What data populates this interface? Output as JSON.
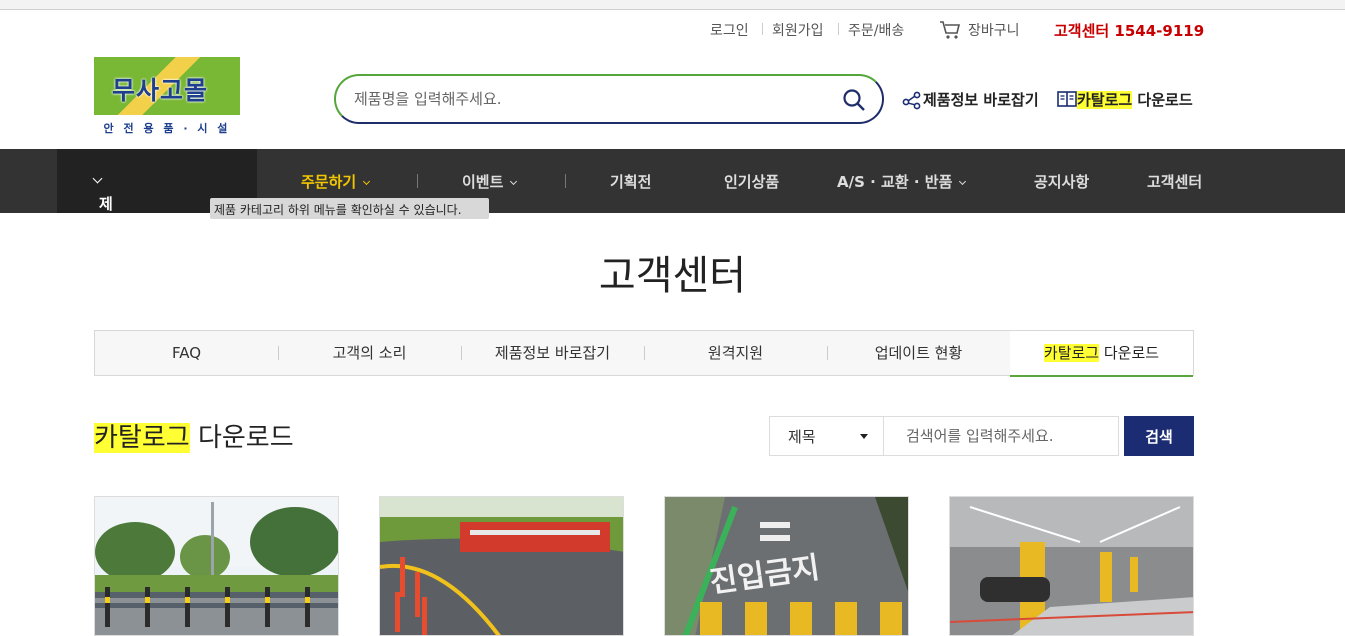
{
  "util_links": {
    "login": "로그인",
    "signup": "회원가입",
    "orders": "주문/배송",
    "cart": "장바구니",
    "cs_phone": "고객센터 1544-9119"
  },
  "logo": {
    "title": "무사고몰",
    "subtitle": "안 전 용 품 · 시 설"
  },
  "search": {
    "placeholder": "제품명을 입력해주세요."
  },
  "header_links": {
    "product_info": "제품정보 바로잡기",
    "catalog_highlight": "카탈로그",
    "catalog_rest": " 다운로드"
  },
  "nav": {
    "category": "제품 카테고리 열기",
    "items": [
      "주문하기",
      "이벤트",
      "기획전",
      "인기상품",
      "A/S · 교환 · 반품",
      "공지사항",
      "고객센터"
    ]
  },
  "tooltip": "제품 카테고리 하위 메뉴를 확인하실 수 있습니다.",
  "page_title": "고객센터",
  "tabs": [
    "FAQ",
    "고객의 소리",
    "제품정보 바로잡기",
    "원격지원",
    "업데이트 현황",
    "카탈로그 다운로드"
  ],
  "active_tab": {
    "highlight": "카탈로그",
    "rest": " 다운로드"
  },
  "section": {
    "title_highlight": "카탈로그",
    "title_rest": " 다운로드"
  },
  "board_search": {
    "select_value": "제목",
    "placeholder": "검색어를 입력해주세요.",
    "button": "검색"
  },
  "colors": {
    "accent_red": "#c80000",
    "nav_bg": "#333333",
    "button_navy": "#1b2c73",
    "tab_underline": "#5aa63c",
    "highlight": "#ffff33"
  }
}
